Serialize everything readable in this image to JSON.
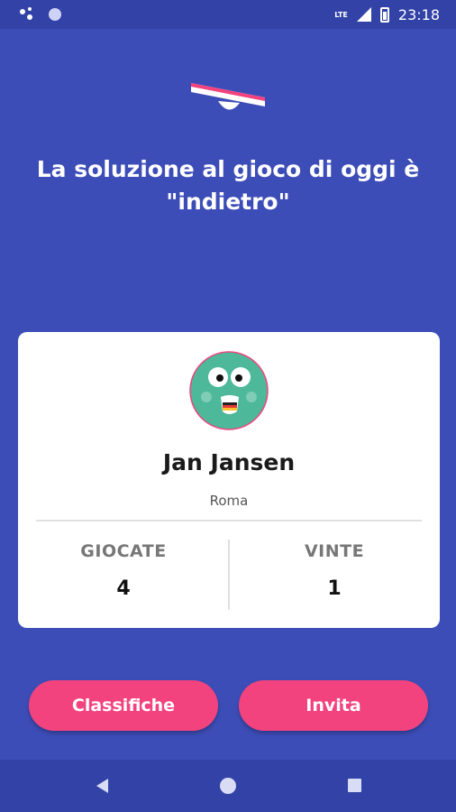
{
  "status_bar": {
    "network_label": "LTE",
    "time": "23:18"
  },
  "headline": "La soluzione al gioco di oggi è \"indietro\"",
  "player": {
    "name": "Jan Jansen",
    "city": "Roma"
  },
  "stats": [
    {
      "label": "GIOCATE",
      "value": "4"
    },
    {
      "label": "VINTE",
      "value": "1"
    }
  ],
  "buttons": {
    "rankings": "Classifiche",
    "invite": "Invita"
  },
  "colors": {
    "background": "#3d4db7",
    "accent": "#f2437e",
    "avatar": "#4db89a"
  }
}
